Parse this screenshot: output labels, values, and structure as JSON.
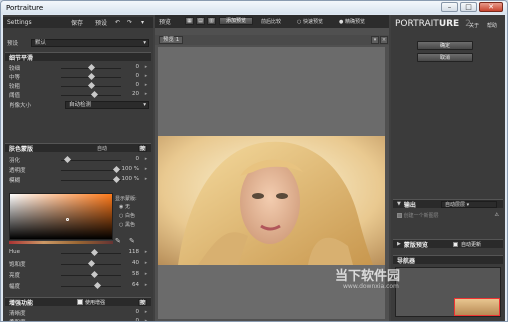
{
  "window": {
    "title": "Portraiture",
    "buttons": [
      "–",
      "□",
      "✕"
    ]
  },
  "left": {
    "settings_label": "Settings",
    "save": "保存",
    "presets": "预设",
    "preset_label": "预设",
    "preset_value": "默认",
    "detail_section": "细节平滑",
    "detail_rows": [
      {
        "label": "较细",
        "value": "0",
        "pos": 0.5
      },
      {
        "label": "中等",
        "value": "0",
        "pos": 0.5
      },
      {
        "label": "较粗",
        "value": "0",
        "pos": 0.5
      },
      {
        "label": "阈值",
        "value": "20",
        "pos": 0.55
      }
    ],
    "size_label": "肖像大小",
    "size_value": "自动检测",
    "mask_section": "肤色蒙版",
    "mask_mode": "自动",
    "mask_btn": "按",
    "mask_rows": [
      {
        "label": "羽化",
        "value": "0",
        "pos": 0.1
      },
      {
        "label": "透明度",
        "value": "100 %",
        "pos": 0.92
      },
      {
        "label": "模糊",
        "value": "100 %",
        "pos": 0.92
      }
    ],
    "display_label": "显示蒙版:",
    "radio_items": [
      "无",
      "白色",
      "黑色"
    ],
    "hsl_rows": [
      {
        "label": "Hue",
        "value": "118",
        "pos": 0.55
      },
      {
        "label": "饱和度",
        "value": "40",
        "pos": 0.5
      },
      {
        "label": "亮度",
        "value": "58",
        "pos": 0.55
      },
      {
        "label": "幅度",
        "value": "64",
        "pos": 0.6
      }
    ],
    "enhance_section": "增强功能",
    "enhance_check": "使用增强",
    "enhance_rows": [
      {
        "label": "清晰度",
        "value": "0"
      },
      {
        "label": "柔和度",
        "value": "0"
      }
    ]
  },
  "center": {
    "preview_tab": "预览",
    "add_preview": "添加预览",
    "compare": "前后比较",
    "radio_fast": "快速预览",
    "radio_full": "精确预览",
    "tab_preview1": "预览 1"
  },
  "right": {
    "logo_a": "PORTRAIT",
    "logo_b": "URE",
    "logo_ver": "2",
    "about": "关于",
    "help": "帮助",
    "ok": "确定",
    "cancel": "取消",
    "output_section": "输出",
    "output_value": "自动层层",
    "output_option": "创建一个新图层",
    "mask_preview": "蒙版预览",
    "auto_update": "自动更新",
    "navigator": "导航器"
  },
  "watermark": {
    "text": "当下软件园",
    "url": "www.downxia.com"
  }
}
